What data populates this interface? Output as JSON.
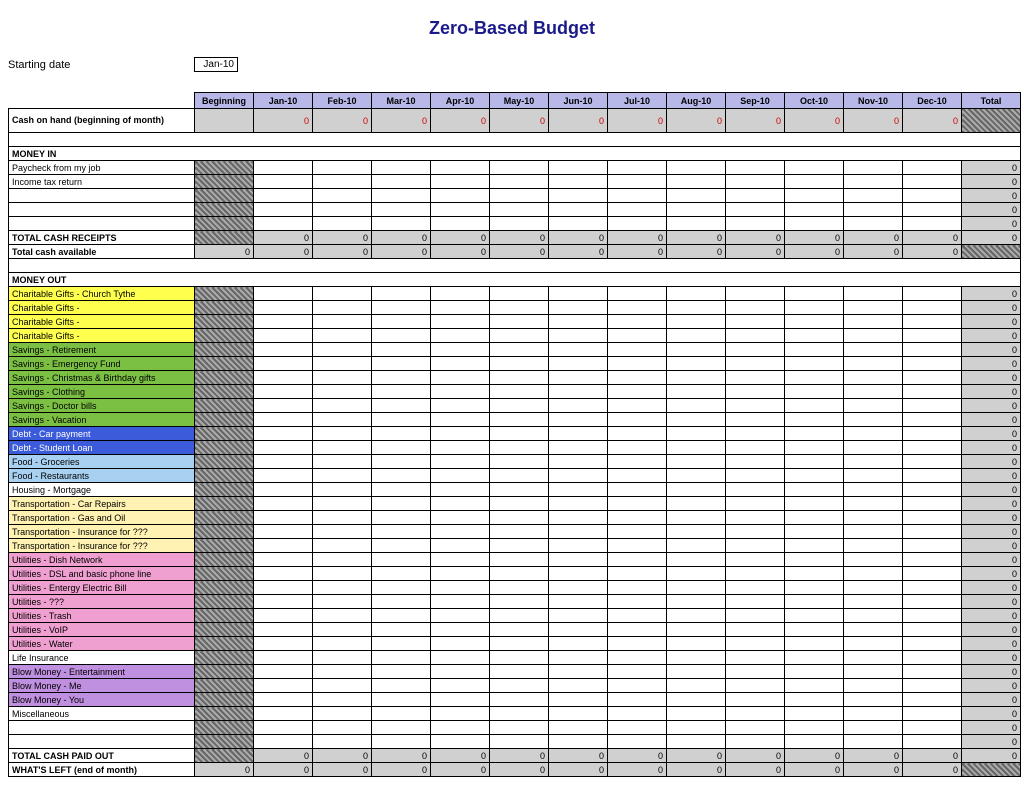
{
  "title": "Zero-Based Budget",
  "startLabel": "Starting date",
  "startValue": "Jan-10",
  "headers": [
    "Beginning",
    "Jan-10",
    "Feb-10",
    "Mar-10",
    "Apr-10",
    "May-10",
    "Jun-10",
    "Jul-10",
    "Aug-10",
    "Sep-10",
    "Oct-10",
    "Nov-10",
    "Dec-10",
    "Total"
  ],
  "cashOnHand": {
    "label": "Cash on hand (beginning of month)",
    "months": [
      0,
      0,
      0,
      0,
      0,
      0,
      0,
      0,
      0,
      0,
      0,
      0
    ]
  },
  "moneyInHeader": "MONEY IN",
  "moneyIn": [
    {
      "label": "Paycheck from my job",
      "total": 0
    },
    {
      "label": "Income tax return",
      "total": 0
    },
    {
      "label": "",
      "total": 0
    },
    {
      "label": "",
      "total": 0
    },
    {
      "label": "",
      "total": 0
    }
  ],
  "totalReceipts": {
    "label": "TOTAL CASH RECEIPTS",
    "months": [
      0,
      0,
      0,
      0,
      0,
      0,
      0,
      0,
      0,
      0,
      0,
      0
    ],
    "total": 0
  },
  "totalAvailable": {
    "label": "Total cash available",
    "beginning": 0,
    "months": [
      0,
      0,
      0,
      0,
      0,
      0,
      0,
      0,
      0,
      0,
      0,
      0
    ]
  },
  "moneyOutHeader": "MONEY OUT",
  "moneyOut": [
    {
      "label": "Charitable Gifts - Church Tythe",
      "color": "c-yellow",
      "total": 0
    },
    {
      "label": "Charitable Gifts -",
      "color": "c-yellow",
      "total": 0
    },
    {
      "label": "Charitable Gifts -",
      "color": "c-yellow",
      "total": 0
    },
    {
      "label": "Charitable Gifts -",
      "color": "c-yellow",
      "total": 0
    },
    {
      "label": "Savings - Retirement",
      "color": "c-green",
      "total": 0
    },
    {
      "label": "Savings - Emergency Fund",
      "color": "c-green",
      "total": 0
    },
    {
      "label": "Savings - Christmas & Birthday gifts",
      "color": "c-green",
      "total": 0
    },
    {
      "label": "Savings - Clothing",
      "color": "c-green",
      "total": 0
    },
    {
      "label": "Savings - Doctor bills",
      "color": "c-green",
      "total": 0
    },
    {
      "label": "Savings - Vacation",
      "color": "c-green",
      "total": 0
    },
    {
      "label": "Debt - Car payment",
      "color": "c-blue",
      "total": 0
    },
    {
      "label": "Debt - Student Loan",
      "color": "c-blue",
      "total": 0
    },
    {
      "label": "Food - Groceries",
      "color": "c-lblue",
      "total": 0
    },
    {
      "label": "Food - Restaurants",
      "color": "c-lblue",
      "total": 0
    },
    {
      "label": "Housing - Mortgage",
      "color": "",
      "total": 0
    },
    {
      "label": "Transportation - Car Repairs",
      "color": "c-cream",
      "total": 0
    },
    {
      "label": "Transportation - Gas and Oil",
      "color": "c-cream",
      "total": 0
    },
    {
      "label": "Transportation - Insurance for ???",
      "color": "c-cream",
      "total": 0
    },
    {
      "label": "Transportation - Insurance for ???",
      "color": "c-cream",
      "total": 0
    },
    {
      "label": "Utilities - Dish Network",
      "color": "c-pink",
      "total": 0
    },
    {
      "label": "Utilities - DSL and basic phone line",
      "color": "c-pink",
      "total": 0
    },
    {
      "label": "Utilities - Entergy Electric Bill",
      "color": "c-pink",
      "total": 0
    },
    {
      "label": "Utilities - ???",
      "color": "c-pink",
      "total": 0
    },
    {
      "label": "Utilities - Trash",
      "color": "c-pink",
      "total": 0
    },
    {
      "label": "Utilities - VoIP",
      "color": "c-pink",
      "total": 0
    },
    {
      "label": "Utilities - Water",
      "color": "c-pink",
      "total": 0
    },
    {
      "label": "Life Insurance",
      "color": "",
      "total": 0
    },
    {
      "label": "Blow Money - Entertainment",
      "color": "c-purple",
      "total": 0
    },
    {
      "label": "Blow Money - Me",
      "color": "c-purple",
      "total": 0
    },
    {
      "label": "Blow Money - You",
      "color": "c-purple",
      "total": 0
    },
    {
      "label": "Miscellaneous",
      "color": "",
      "total": 0
    },
    {
      "label": "",
      "color": "",
      "total": 0
    },
    {
      "label": "",
      "color": "",
      "total": 0
    }
  ],
  "totalPaidOut": {
    "label": "TOTAL CASH PAID OUT",
    "months": [
      0,
      0,
      0,
      0,
      0,
      0,
      0,
      0,
      0,
      0,
      0,
      0
    ],
    "total": 0
  },
  "whatsLeft": {
    "label": "WHAT'S LEFT (end of month)",
    "beginning": 0,
    "months": [
      0,
      0,
      0,
      0,
      0,
      0,
      0,
      0,
      0,
      0,
      0,
      0
    ]
  }
}
